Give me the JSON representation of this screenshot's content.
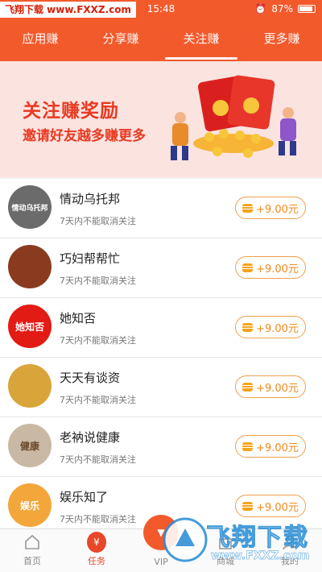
{
  "status_bar": {
    "watermark": "飞翔下载 www.FXXZ.com",
    "time": "15:48",
    "battery": "87%"
  },
  "tabs": [
    {
      "label": "应用赚",
      "active": false
    },
    {
      "label": "分享赚",
      "active": false
    },
    {
      "label": "关注赚",
      "active": true
    },
    {
      "label": "更多赚",
      "active": false
    }
  ],
  "banner": {
    "title": "关注赚奖励",
    "subtitle": "邀请好友越多赚更多"
  },
  "list": [
    {
      "name": "情动乌托邦",
      "note": "7天内不能取消关注",
      "reward": "+9.00元",
      "avatar_text": "情动乌托邦",
      "avatar_color": "#6b6b6b"
    },
    {
      "name": "巧妇帮帮忙",
      "note": "7天内不能取消关注",
      "reward": "+9.00元",
      "avatar_text": "",
      "avatar_color": "#8a3b1f"
    },
    {
      "name": "她知否",
      "note": "7天内不能取消关注",
      "reward": "+9.00元",
      "avatar_text": "她知否",
      "avatar_color": "#e21b14"
    },
    {
      "name": "天天有谈资",
      "note": "7天内不能取消关注",
      "reward": "+9.00元",
      "avatar_text": "",
      "avatar_color": "#d9a53a"
    },
    {
      "name": "老衲说健康",
      "note": "7天内不能取消关注",
      "reward": "+9.00元",
      "avatar_text": "健康",
      "avatar_color": "#c9b9a4"
    },
    {
      "name": "娱乐知了",
      "note": "7天内不能取消关注",
      "reward": "+9.00元",
      "avatar_text": "娱乐",
      "avatar_color": "#f3a63a"
    }
  ],
  "bottom_nav": [
    {
      "label": "首页",
      "icon": "home-icon"
    },
    {
      "label": "任务",
      "icon": "task-icon",
      "active": true,
      "glyph": "¥"
    },
    {
      "label": "VIP",
      "icon": "vip-icon"
    },
    {
      "label": "商城",
      "icon": "shop-icon"
    },
    {
      "label": "我的",
      "icon": "profile-icon"
    }
  ],
  "watermark_overlay": {
    "text": "飞翔下载",
    "url": "www.FXXZ.com"
  },
  "colors": {
    "accent": "#f25a2c",
    "reward": "#f08a1a",
    "banner_bg": "#fbe3df"
  }
}
